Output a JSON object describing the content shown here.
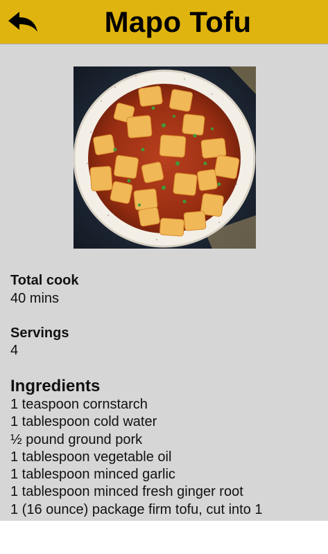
{
  "header": {
    "title": "Mapo Tofu",
    "background": "#e0b40e",
    "back_icon": "back-arrow-icon"
  },
  "recipe": {
    "image_alt": "Mapo Tofu dish in a white bowl",
    "total_cook_label": "Total cook",
    "total_cook_value": "40 mins",
    "servings_label": "Servings",
    "servings_value": "4",
    "ingredients_title": "Ingredients",
    "ingredients": [
      "1 teaspoon cornstarch",
      "1 tablespoon cold water",
      "½ pound ground pork",
      "1 tablespoon vegetable oil",
      "1 tablespoon minced garlic",
      "1 tablespoon minced fresh ginger root",
      "1 (16 ounce) package firm tofu, cut into 1"
    ]
  }
}
